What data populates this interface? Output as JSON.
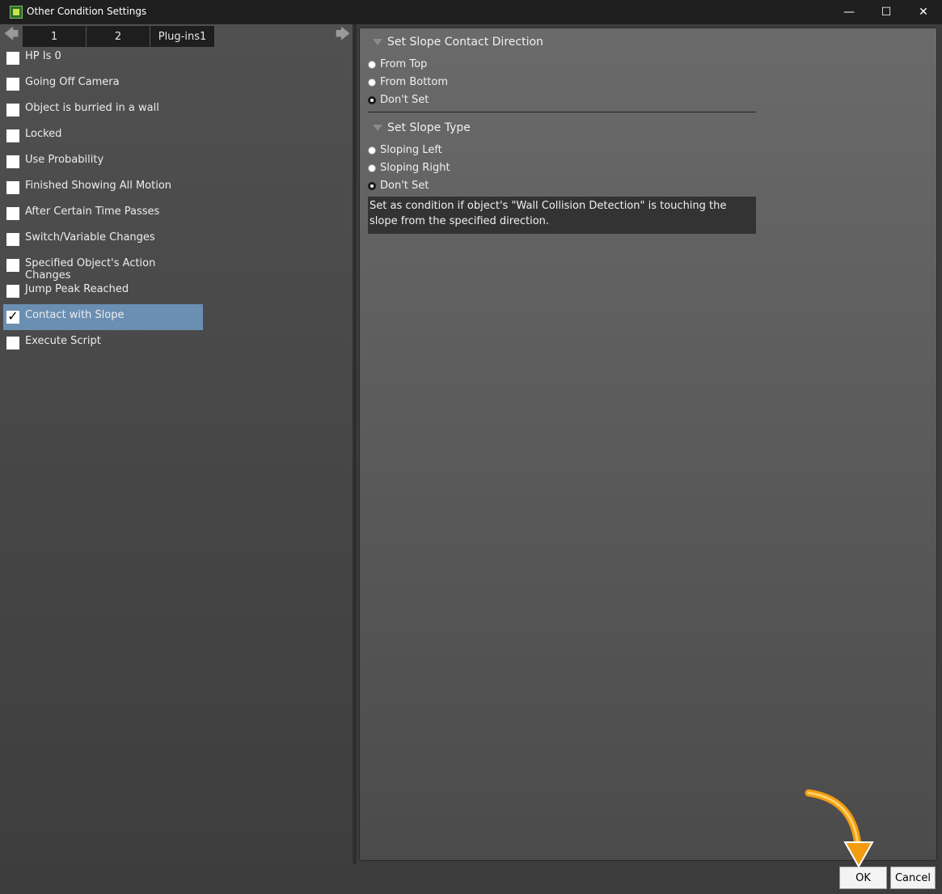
{
  "window": {
    "title": "Other Condition Settings",
    "minimize": "—",
    "maximize": "☐",
    "close": "✕"
  },
  "tabs": {
    "prev_arrow": "🡄",
    "next_arrow": "🡆",
    "items": [
      "1",
      "2",
      "Plug-ins1"
    ]
  },
  "conditions": [
    {
      "label": "HP Is 0",
      "checked": false
    },
    {
      "label": "Going Off Camera",
      "checked": false
    },
    {
      "label": "Object is burried in a wall",
      "checked": false
    },
    {
      "label": "Locked",
      "checked": false
    },
    {
      "label": "Use Probability",
      "checked": false
    },
    {
      "label": "Finished Showing All Motion",
      "checked": false
    },
    {
      "label": "After Certain Time Passes",
      "checked": false
    },
    {
      "label": "Switch/Variable Changes",
      "checked": false
    },
    {
      "label": "Specified Object's Action Changes",
      "checked": false
    },
    {
      "label": "Jump Peak Reached",
      "checked": false
    },
    {
      "label": "Contact with Slope",
      "checked": true,
      "check_mark": "✓"
    },
    {
      "label": "Execute Script",
      "checked": false
    }
  ],
  "slope_direction": {
    "header": "Set Slope Contact Direction",
    "options": [
      "From Top",
      "From Bottom",
      "Don't Set"
    ],
    "selected": "Don't Set"
  },
  "slope_type": {
    "header": "Set Slope Type",
    "options": [
      "Sloping Left",
      "Sloping Right",
      "Don't Set"
    ],
    "selected": "Don't Set"
  },
  "description": "Set as condition if object's \"Wall Collision Detection\" is touching the slope from the specified direction.",
  "buttons": {
    "ok": "OK",
    "cancel": "Cancel"
  },
  "colors": {
    "selected_row": "#6a8fb3",
    "hint_arrow": "#f39c12"
  }
}
